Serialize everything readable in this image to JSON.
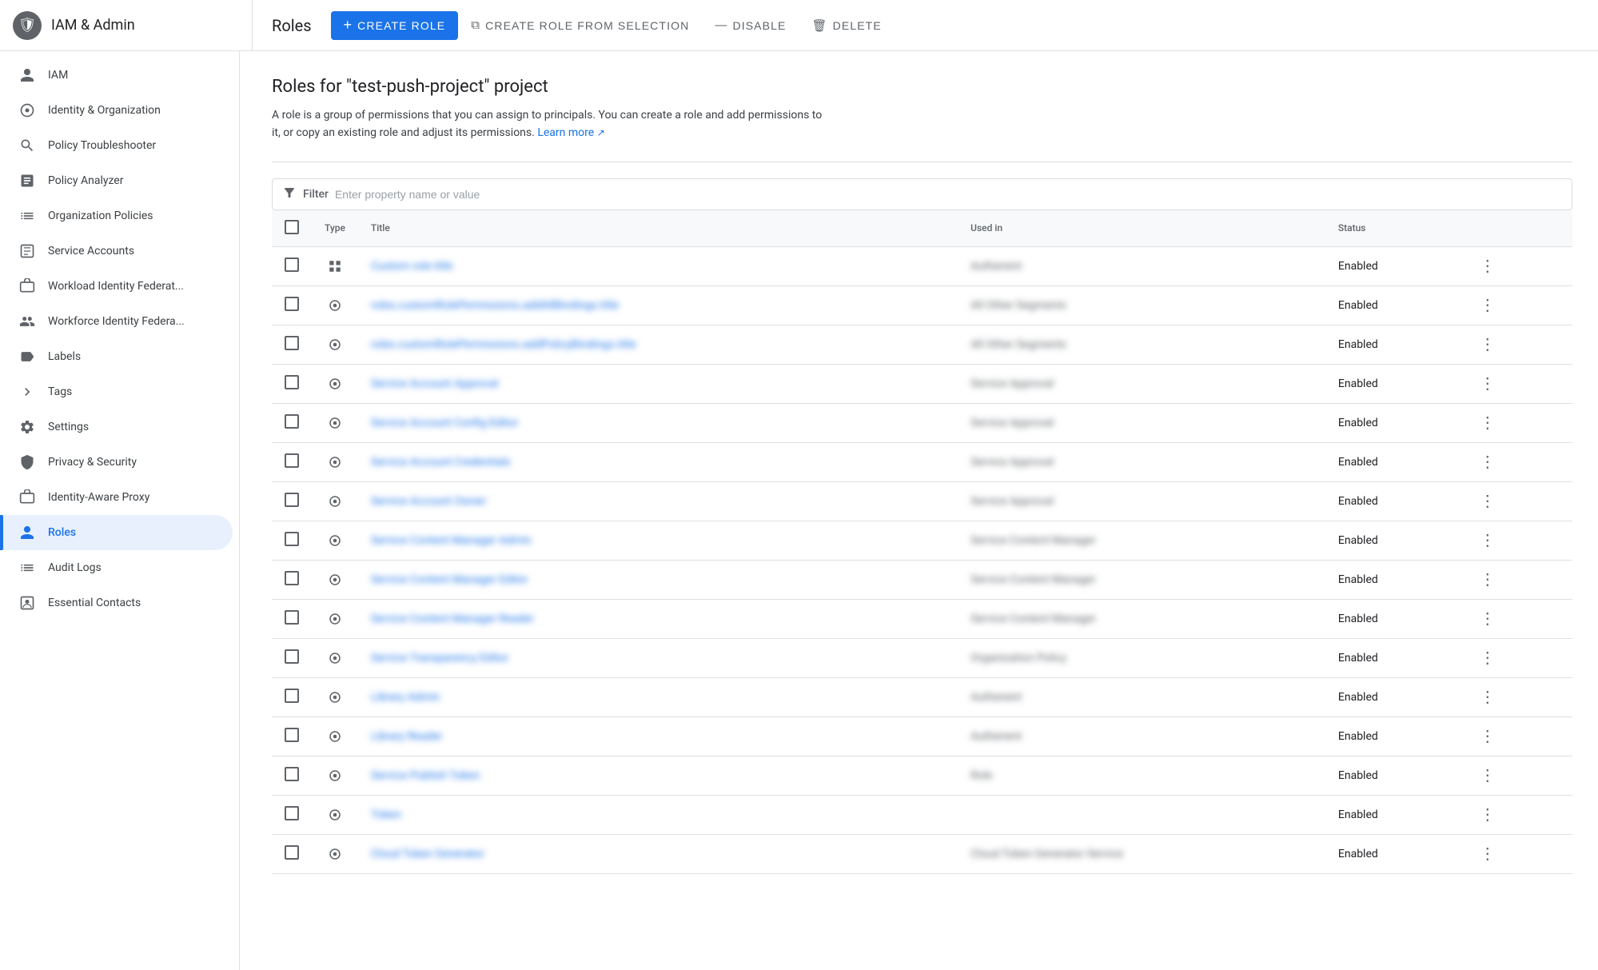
{
  "brand": {
    "icon": "🛡",
    "title": "IAM & Admin"
  },
  "header": {
    "page_title": "Roles",
    "actions": [
      {
        "id": "create-role",
        "label": "CREATE ROLE",
        "icon": "+",
        "primary": true
      },
      {
        "id": "create-role-from-selection",
        "label": "CREATE ROLE FROM SELECTION",
        "icon": "⧉",
        "primary": false
      },
      {
        "id": "disable",
        "label": "DISABLE",
        "icon": "—",
        "primary": false
      },
      {
        "id": "delete",
        "label": "DELETE",
        "icon": "🗑",
        "primary": false
      }
    ]
  },
  "sidebar": {
    "items": [
      {
        "id": "iam",
        "label": "IAM",
        "icon": "👤",
        "active": false
      },
      {
        "id": "identity-organization",
        "label": "Identity & Organization",
        "icon": "⊙",
        "active": false
      },
      {
        "id": "policy-troubleshooter",
        "label": "Policy Troubleshooter",
        "icon": "🔧",
        "active": false
      },
      {
        "id": "policy-analyzer",
        "label": "Policy Analyzer",
        "icon": "📋",
        "active": false
      },
      {
        "id": "organization-policies",
        "label": "Organization Policies",
        "icon": "☰",
        "active": false
      },
      {
        "id": "service-accounts",
        "label": "Service Accounts",
        "icon": "⊡",
        "active": false
      },
      {
        "id": "workload-identity-federation",
        "label": "Workload Identity Federat...",
        "icon": "⊟",
        "active": false
      },
      {
        "id": "workforce-identity-federation",
        "label": "Workforce Identity Federa...",
        "icon": "⊟",
        "active": false
      },
      {
        "id": "labels",
        "label": "Labels",
        "icon": "🏷",
        "active": false
      },
      {
        "id": "tags",
        "label": "Tags",
        "icon": "❯",
        "active": false
      },
      {
        "id": "settings",
        "label": "Settings",
        "icon": "⚙",
        "active": false
      },
      {
        "id": "privacy-security",
        "label": "Privacy & Security",
        "icon": "🛡",
        "active": false
      },
      {
        "id": "identity-aware-proxy",
        "label": "Identity-Aware Proxy",
        "icon": "⊟",
        "active": false
      },
      {
        "id": "roles",
        "label": "Roles",
        "icon": "👤",
        "active": true
      },
      {
        "id": "audit-logs",
        "label": "Audit Logs",
        "icon": "☰",
        "active": false
      },
      {
        "id": "essential-contacts",
        "label": "Essential Contacts",
        "icon": "⊡",
        "active": false
      }
    ]
  },
  "content": {
    "title": "Roles for \"test-push-project\" project",
    "description": "A role is a group of permissions that you can assign to principals. You can create a role and add permissions to it, or copy an existing role and adjust its permissions.",
    "learn_more": "Learn more",
    "filter": {
      "placeholder": "Enter property name or value",
      "label": "Filter"
    },
    "table": {
      "columns": [
        "",
        "Type",
        "Title",
        "Used in",
        "Status",
        ""
      ],
      "rows": [
        {
          "type": "grid",
          "title": "blurred-blue-1",
          "used_in": "blurred-gray-1",
          "status": "Enabled"
        },
        {
          "type": "circle",
          "title": "blurred-blue-2",
          "used_in": "blurred-gray-2",
          "status": "Enabled"
        },
        {
          "type": "circle",
          "title": "blurred-blue-3",
          "used_in": "blurred-gray-3",
          "status": "Enabled"
        },
        {
          "type": "circle",
          "title": "blurred-blue-4",
          "used_in": "blurred-gray-4",
          "status": "Enabled"
        },
        {
          "type": "circle",
          "title": "blurred-blue-5",
          "used_in": "blurred-gray-5",
          "status": "Enabled"
        },
        {
          "type": "circle",
          "title": "blurred-blue-6",
          "used_in": "blurred-gray-6",
          "status": "Enabled"
        },
        {
          "type": "circle",
          "title": "blurred-blue-7",
          "used_in": "blurred-gray-7",
          "status": "Enabled"
        },
        {
          "type": "circle",
          "title": "blurred-blue-8",
          "used_in": "blurred-gray-8",
          "status": "Enabled"
        },
        {
          "type": "circle",
          "title": "blurred-blue-9",
          "used_in": "blurred-gray-9",
          "status": "Enabled"
        },
        {
          "type": "circle",
          "title": "blurred-blue-10",
          "used_in": "blurred-gray-10",
          "status": "Enabled"
        },
        {
          "type": "circle",
          "title": "blurred-blue-11",
          "used_in": "blurred-gray-11",
          "status": "Enabled"
        },
        {
          "type": "circle",
          "title": "blurred-blue-12",
          "used_in": "blurred-gray-12",
          "status": "Enabled"
        },
        {
          "type": "circle",
          "title": "blurred-blue-13",
          "used_in": "blurred-gray-13",
          "status": "Enabled"
        },
        {
          "type": "circle",
          "title": "blurred-blue-14",
          "used_in": "blurred-gray-14",
          "status": "Enabled"
        },
        {
          "type": "circle",
          "title": "blurred-blue-15",
          "used_in": "blurred-gray-15",
          "status": "Enabled"
        },
        {
          "type": "circle",
          "title": "blurred-blue-16",
          "used_in": "blurred-gray-16",
          "status": "Enabled"
        }
      ],
      "blurred_titles": [
        "Custom role title",
        "roles.customRolePermissions.addAllBindings.title",
        "roles.customRolePermissions.addPolicyBindings.title",
        "Service Account Approval",
        "Service Account Config Editor",
        "Service Account Credentials",
        "Service Account Owner",
        "Service Content Manager Admin",
        "Service Content Manager Editor",
        "Service Content Manager Reader",
        "Service Transparency Editor",
        "Library Admin",
        "Library Reader",
        "Service Publish Token",
        "Token",
        "Cloud Token Generator"
      ],
      "blurred_used_in": [
        "Authenent",
        "All Other Segments",
        "All Other Segments",
        "Service Approval",
        "Service Approval",
        "Service Approval",
        "Service Approval",
        "Service Content Manager",
        "Service Content Manager",
        "Service Content Manager",
        "Organization Policy",
        "Authenent",
        "Authenent",
        "Role",
        "",
        "Cloud Token Generator Service"
      ]
    }
  }
}
